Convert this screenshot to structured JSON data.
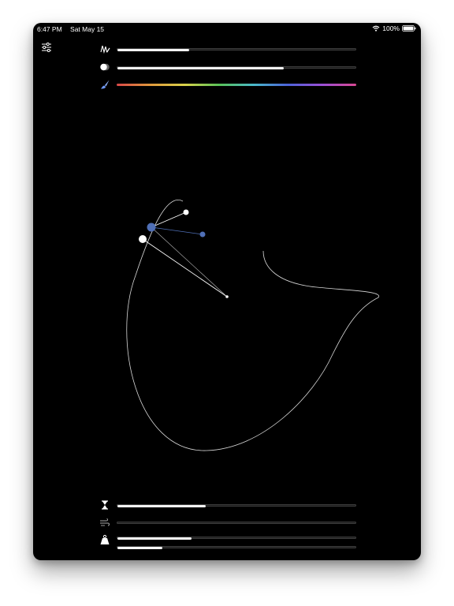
{
  "status_bar": {
    "time": "6:47 PM",
    "date": "Sat May 15",
    "battery": "100%"
  },
  "icons": {
    "settings": "sliders-icon",
    "stroke_width": "pen-scribble-icon",
    "opacity": "circle-half-icon",
    "color": "paintbrush-icon",
    "duration": "hourglass-icon",
    "wind": "wind-icon",
    "weight": "weight-icon"
  },
  "controls": {
    "stroke_width": 0.3,
    "opacity": 0.7,
    "duration": 0.37,
    "wind": 0.0,
    "weight": 0.31,
    "weight_secondary": 0.19
  },
  "colors": {
    "background": "#000000",
    "slider_fill": "#f5f5f5",
    "curve": "#d9d9d9",
    "accent_handle": "#4f6fb6"
  }
}
